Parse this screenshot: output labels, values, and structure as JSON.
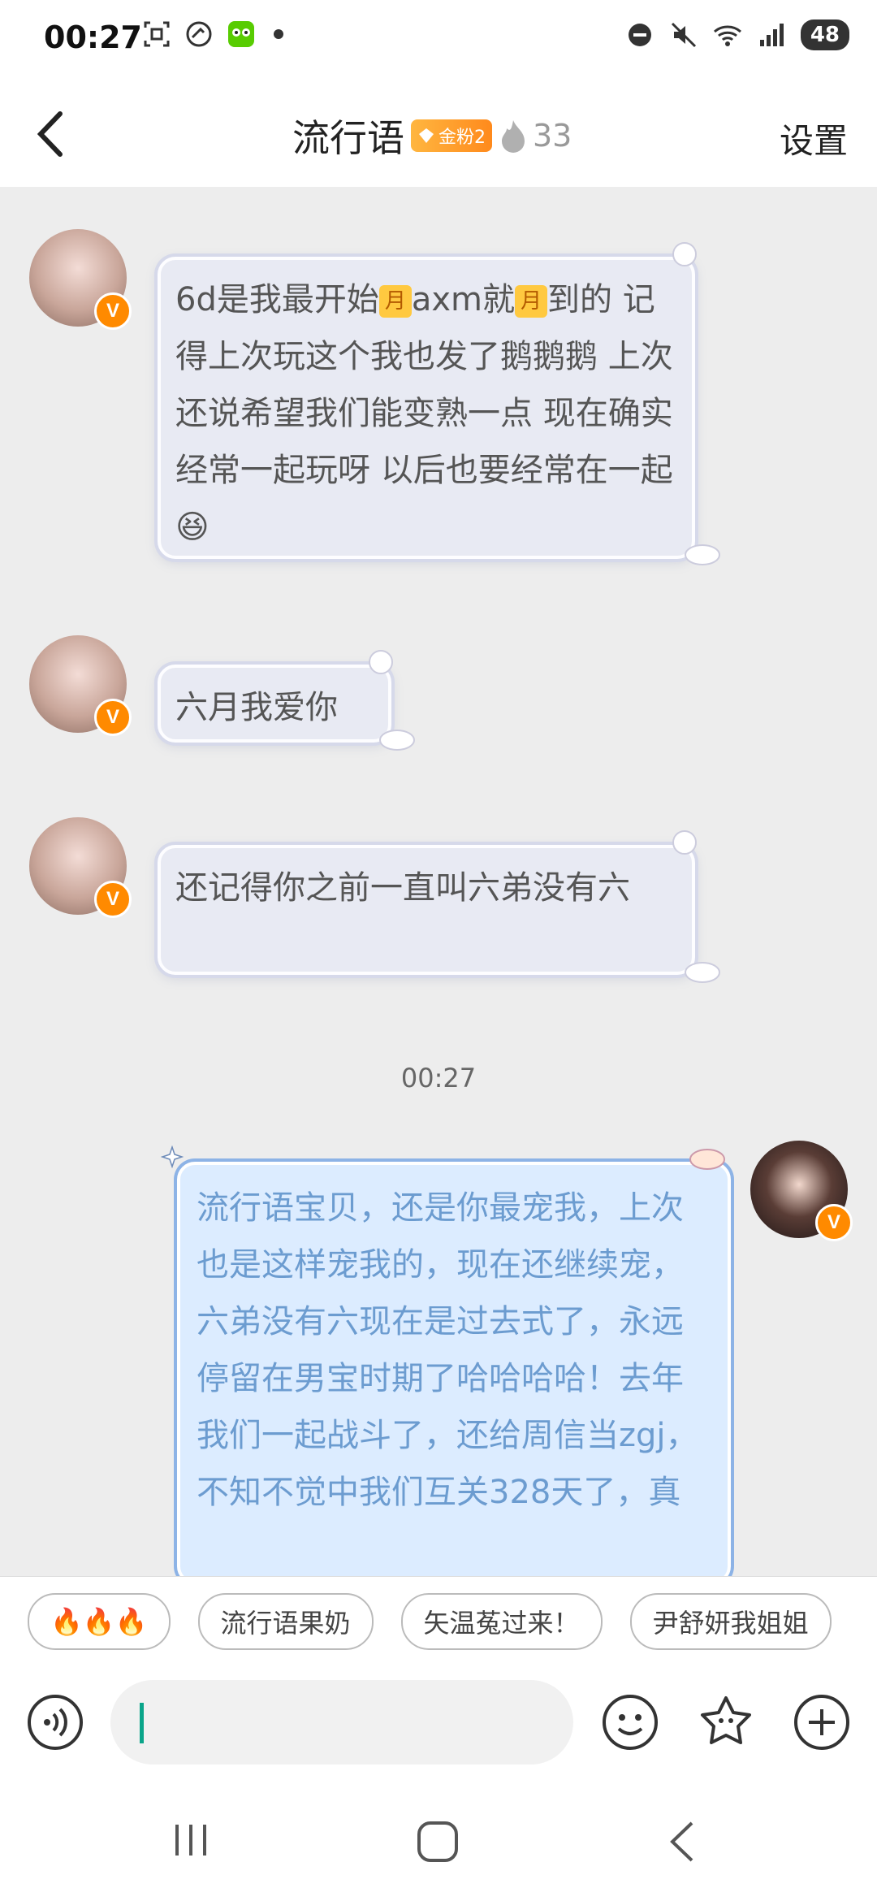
{
  "status_bar": {
    "time": "00:27",
    "battery": "48"
  },
  "header": {
    "title": "流行语",
    "fan_badge": "金粉2",
    "fire_count": "33",
    "settings_label": "设置"
  },
  "messages": [
    {
      "side": "left",
      "line1_a": "6d是我最开始",
      "moon": "月",
      "line1_b": "axm就",
      "line1_c": "到",
      "rest": "的 记得上次玩这个我也发了鹅鹅鹅 上次还说希望我们能变熟一点 现在确实经常一起玩呀 以后也要经常在一起"
    },
    {
      "side": "left",
      "text": "六月我爱你"
    },
    {
      "side": "left",
      "text": "还记得你之前一直叫六弟没有六"
    },
    {
      "side": "right",
      "text": "流行语宝贝，还是你最宠我，上次也是这样宠我的，现在还继续宠，六弟没有六现在是过去式了，永远停留在男宝时期了哈哈哈哈！去年我们一起战斗了，还给周信当zgj，不知不觉中我们互关328天了，真"
    }
  ],
  "timestamp": "00:27",
  "quick_replies": [
    "🔥🔥🔥",
    "流行语果奶",
    "矢温菟过来！",
    "尹舒妍我姐姐"
  ],
  "colors": {
    "accent": "#ff8a00",
    "self_bubble": "#dcecff",
    "other_bubble": "#e8eaf3",
    "caret": "#0aa58a"
  }
}
